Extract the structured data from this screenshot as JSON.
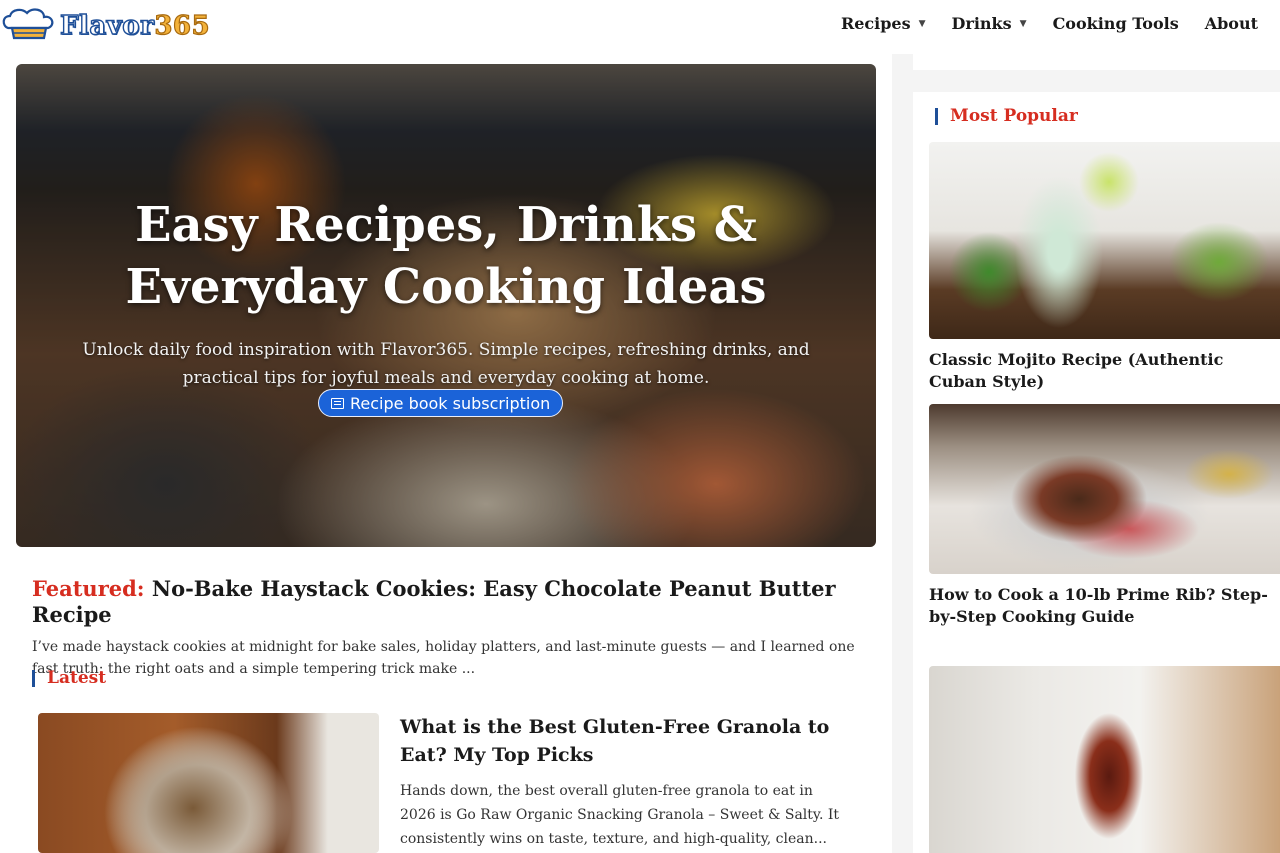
{
  "brand": {
    "name_part1": "Flavor",
    "name_part2": "365"
  },
  "nav": {
    "items": [
      {
        "label": "Recipes",
        "has_dropdown": true
      },
      {
        "label": "Drinks",
        "has_dropdown": true
      },
      {
        "label": "Cooking Tools",
        "has_dropdown": false
      },
      {
        "label": "About",
        "has_dropdown": false
      }
    ]
  },
  "hero": {
    "title_line1": "Easy Recipes, Drinks &",
    "title_line2": "Everyday Cooking Ideas",
    "subtitle": "Unlock daily food inspiration with Flavor365. Simple recipes, refreshing drinks, and practical tips for joyful meals and everyday cooking at home.",
    "cta_label": "Recipe book subscription",
    "cta_icon": "newspaper-icon"
  },
  "featured": {
    "tag": "Featured:",
    "title": "No-Bake Haystack Cookies: Easy Chocolate Peanut Butter Recipe",
    "excerpt": "I’ve made haystack cookies at midnight for bake sales, holiday platters, and last-minute guests — and I learned one fast truth: the right oats and a simple tempering trick make ..."
  },
  "latest": {
    "heading": "Latest",
    "posts": [
      {
        "title": "What is the Best Gluten-Free Granola to Eat? My Top Picks",
        "excerpt": "Hands down, the best overall gluten-free granola to eat in 2026 is Go Raw Organic Snacking Granola – Sweet & Salty. It consistently wins on taste, texture, and high-quality, clean..."
      }
    ]
  },
  "sidebar": {
    "heading": "Most Popular",
    "items": [
      {
        "title": "Classic Mojito Recipe (Authentic Cuban Style)"
      },
      {
        "title": "How to Cook a 10-lb Prime Rib? Step-by-Step Cooking Guide"
      },
      {
        "title": ""
      }
    ]
  },
  "colors": {
    "accent_red": "#d62d20",
    "brand_blue": "#1e4f98",
    "cta_blue": "#1b63d8",
    "logo_orange": "#f3b23a"
  }
}
